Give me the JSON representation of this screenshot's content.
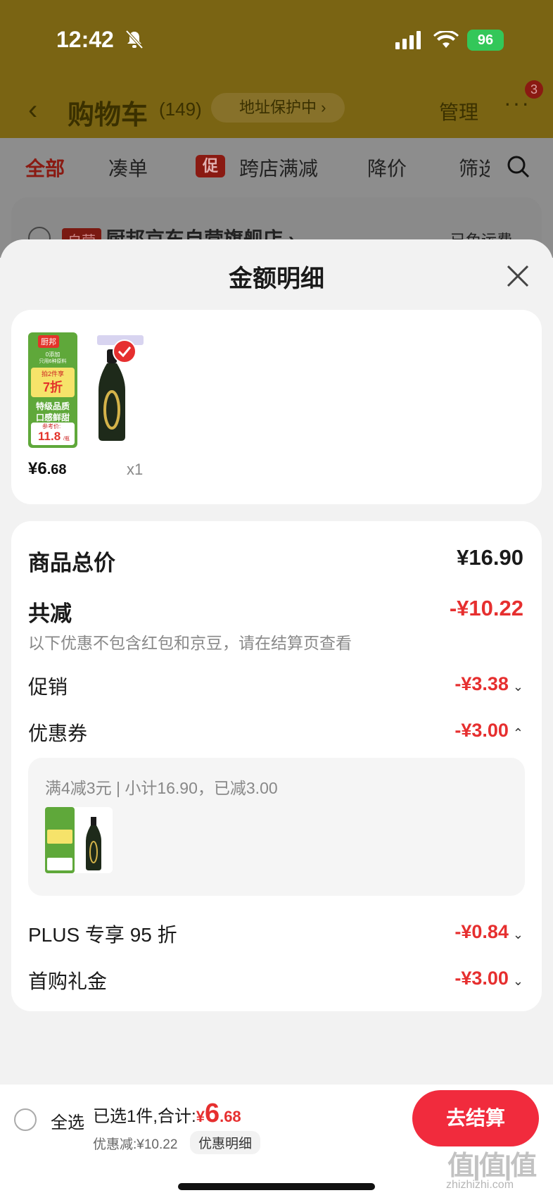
{
  "status_bar": {
    "time": "12:42",
    "battery": "96"
  },
  "nav": {
    "title": "购物车",
    "count": "(149)",
    "address_badge": "地址保护中 ›",
    "manage": "管理",
    "more_badge": "3"
  },
  "filters": {
    "all": "全部",
    "combine": "凑单",
    "promo_badge": "促",
    "cross_store": "跨店满减",
    "price_drop": "降价",
    "filter": "筛选"
  },
  "store": {
    "tag": "自营",
    "name": "厨邦京东自营旗舰店 ›",
    "shipping": "已免运费"
  },
  "sheet": {
    "title": "金额明细",
    "product": {
      "price_main": "¥6",
      "price_decimal": ".68",
      "qty": "x1",
      "image": {
        "brand": "厨邦",
        "line1": "0添加",
        "line2": "只用6种原料",
        "promo": "拍2件享",
        "discount": "7折",
        "quality1": "特级品质",
        "quality2": "口感鲜甜",
        "ref_label": "参考价:",
        "ref_price": "11.8",
        "ref_unit": "/瓶"
      }
    },
    "summary": {
      "total_label": "商品总价",
      "total_value": "¥16.90",
      "discount_label": "共减",
      "discount_value": "-¥10.22",
      "note": "以下优惠不包含红包和京豆，请在结算页查看",
      "rows": [
        {
          "label": "促销",
          "value": "-¥3.38",
          "chevron": "down"
        },
        {
          "label": "优惠券",
          "value": "-¥3.00",
          "chevron": "up"
        }
      ],
      "coupon_detail": "满4减3元 | 小计16.90，已减3.00",
      "rows2": [
        {
          "label": "PLUS 专享 95 折",
          "value": "-¥0.84",
          "chevron": "down"
        },
        {
          "label": "首购礼金",
          "value": "-¥3.00",
          "chevron": "down"
        }
      ]
    }
  },
  "footer": {
    "select_all": "全选",
    "selected_text": "已选1件,合计:",
    "total_symbol": "¥",
    "total_main": "6",
    "total_decimal": ".68",
    "discount_text": "优惠减:¥10.22",
    "detail_btn": "优惠明细",
    "checkout": "去结算"
  },
  "watermark": {
    "logo": "值|值|值",
    "url": "zhizhizhi.com"
  },
  "colors": {
    "red": "#e62f2f",
    "checkout": "#f12b3d",
    "header_bg": "#7a6413"
  }
}
